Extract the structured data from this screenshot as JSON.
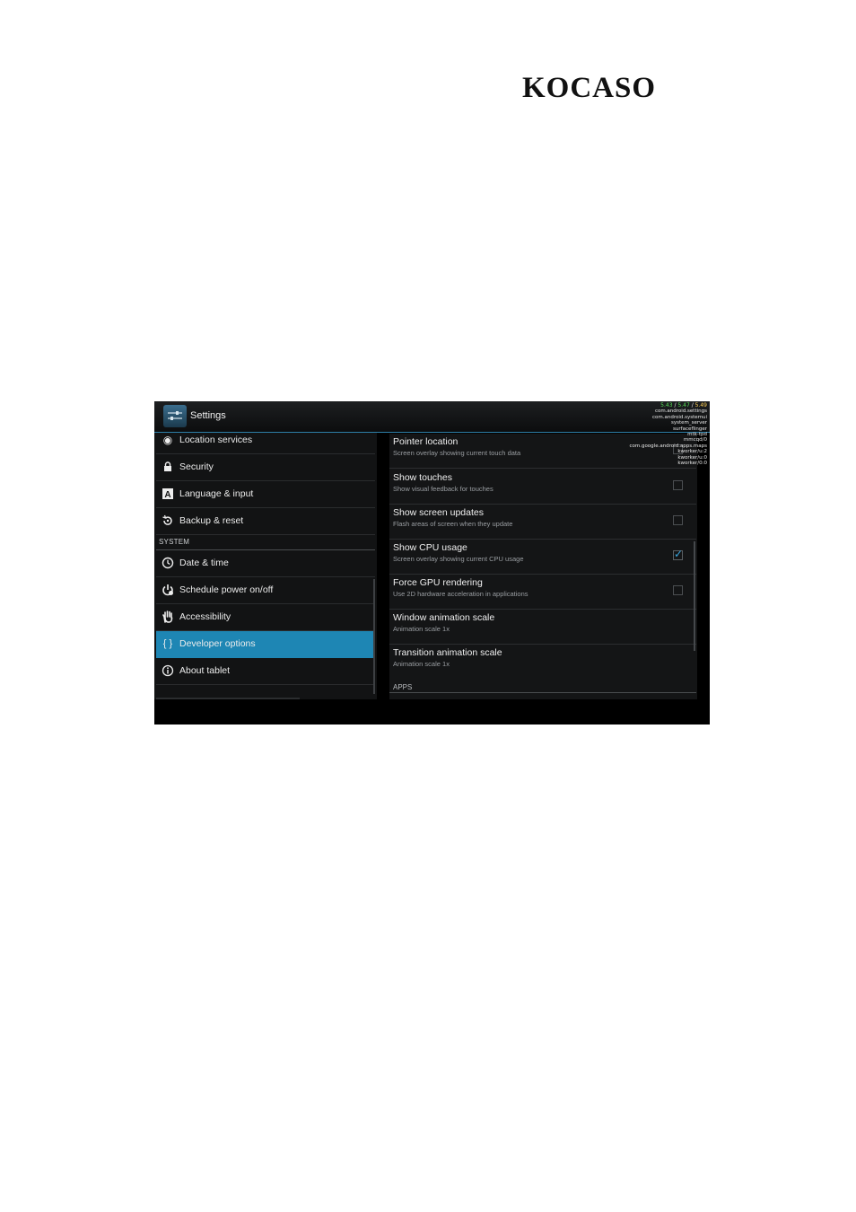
{
  "brand": {
    "logo": "KOCASO"
  },
  "action_bar": {
    "title": "Settings",
    "icon": "settings-app-icon"
  },
  "cpu_overlay": {
    "load": [
      "5.43",
      "5.47",
      "5.49"
    ],
    "processes": [
      "com.android.settings",
      "com.android.systemui",
      "system_server",
      "surfaceflinger",
      "mtk-tpd",
      "mmcqd/0",
      "com.google.android.apps.maps",
      "kworker/u:2",
      "kworker/u:0",
      "kworker/0:0"
    ]
  },
  "sidebar": {
    "items": [
      {
        "label": "Location services",
        "icon": "location-icon"
      },
      {
        "label": "Security",
        "icon": "lock-icon"
      },
      {
        "label": "Language & input",
        "icon": "keyboard-a-icon"
      },
      {
        "label": "Backup & reset",
        "icon": "backup-icon"
      }
    ],
    "section_system": "SYSTEM",
    "system_items": [
      {
        "label": "Date & time",
        "icon": "clock-icon"
      },
      {
        "label": "Schedule power on/off",
        "icon": "power-schedule-icon"
      },
      {
        "label": "Accessibility",
        "icon": "hand-icon"
      },
      {
        "label": "Developer options",
        "icon": "braces-icon",
        "selected": true
      },
      {
        "label": "About tablet",
        "icon": "info-icon"
      }
    ],
    "selected_color": "#1e86b4"
  },
  "preferences": [
    {
      "title": "Pointer location",
      "summary": "Screen overlay showing current touch data",
      "checked": false
    },
    {
      "title": "Show touches",
      "summary": "Show visual feedback for touches",
      "checked": false
    },
    {
      "title": "Show screen updates",
      "summary": "Flash areas of screen when they update",
      "checked": false
    },
    {
      "title": "Show CPU usage",
      "summary": "Screen overlay showing current CPU usage",
      "checked": true
    },
    {
      "title": "Force GPU rendering",
      "summary": "Use 2D hardware acceleration in applications",
      "checked": false
    },
    {
      "title": "Window animation scale",
      "summary": "Animation scale 1x"
    },
    {
      "title": "Transition animation scale",
      "summary": "Animation scale 1x"
    }
  ],
  "section_apps": "APPS",
  "accent_color": "#39a7e0"
}
